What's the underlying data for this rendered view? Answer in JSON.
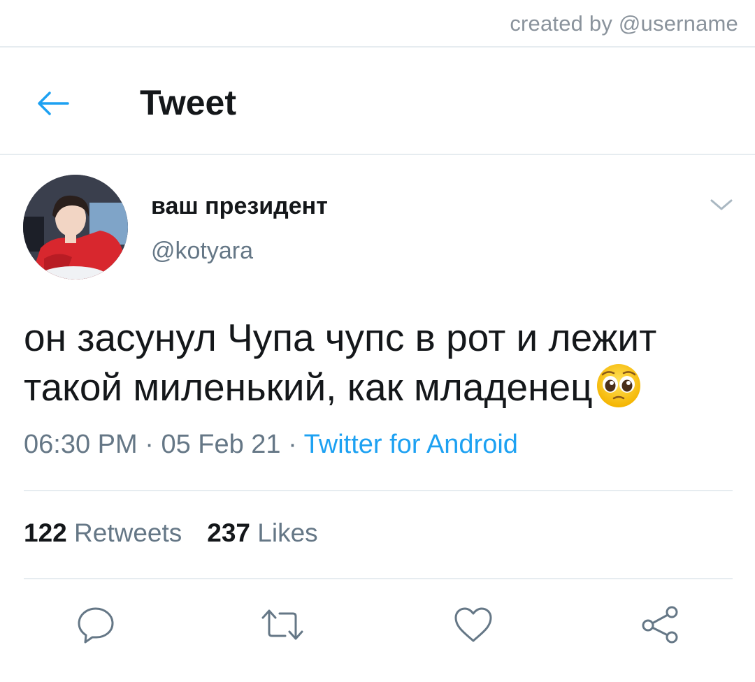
{
  "credit": "created by @username",
  "header": {
    "title": "Tweet",
    "back_icon": "arrow-left-icon"
  },
  "author": {
    "name": "ваш президент",
    "handle": "@kotyara"
  },
  "tweet": {
    "text": "он засунул Чупа чупс в рот и лежит такой миленький, как младенец",
    "emoji": "pleading-face-emoji",
    "time": "06:30 PM",
    "separator": " · ",
    "date": "05 Feb 21",
    "source": "Twitter for Android"
  },
  "stats": {
    "retweets_count": "122",
    "retweets_label": "Retweets",
    "likes_count": "237",
    "likes_label": "Likes"
  },
  "actions": [
    "reply-icon",
    "retweet-icon",
    "like-icon",
    "share-icon"
  ],
  "colors": {
    "accent": "#1da1f2",
    "secondary_text": "#657786",
    "divider": "#e6ecf0"
  }
}
